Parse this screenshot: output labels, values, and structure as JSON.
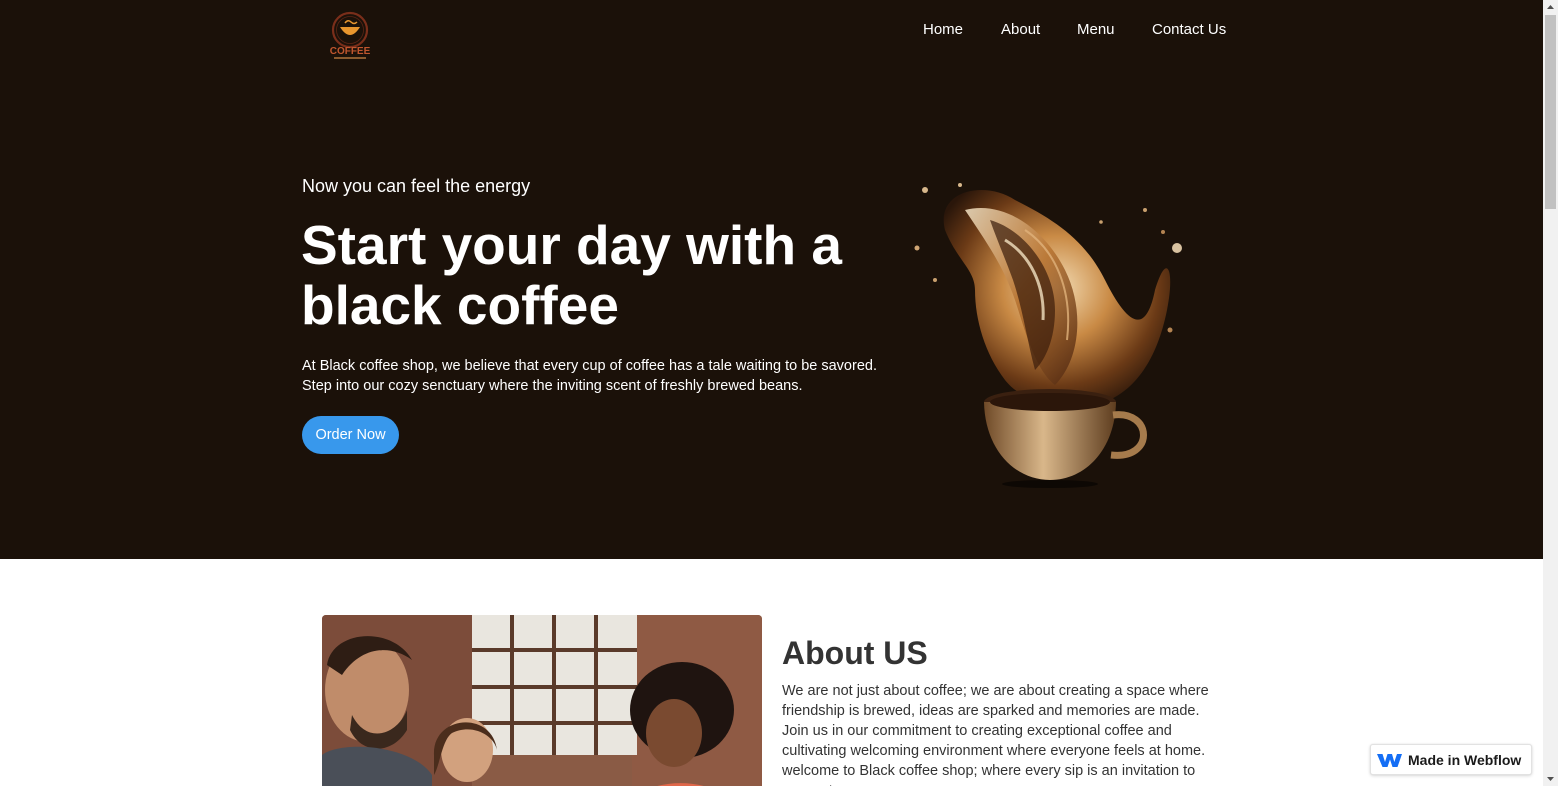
{
  "nav": {
    "home": "Home",
    "about": "About",
    "menu": "Menu",
    "contact": "Contact Us"
  },
  "logo": {
    "icon": "coffee-cup-logo-icon",
    "text": "COFFEE"
  },
  "hero": {
    "eyebrow": "Now you can feel the energy",
    "headline": "Start your day with a black coffee",
    "lead": "At Black coffee shop, we  believe that every cup of coffee has a tale waiting to be savored. Step into our cozy senctuary where the inviting scent of freshly brewed beans.",
    "cta": "Order Now",
    "image": "coffee-splash-cup-image"
  },
  "about": {
    "title": "About US",
    "text": "We are not just about coffee; we are about creating a space where friendship is brewed, ideas are sparked and memories are made. Join us in our commitment to creating exceptional coffee and cultivating welcoming environment where everyone feels at home. welcome to Black coffee shop; where every sip is an invitation to connect.",
    "image": "friends-in-cafe-photo"
  },
  "badge": {
    "label": "Made in Webflow",
    "icon": "webflow-icon"
  },
  "colors": {
    "hero_bg": "#1b1109",
    "button": "#3898ec",
    "text_dark": "#333333"
  }
}
